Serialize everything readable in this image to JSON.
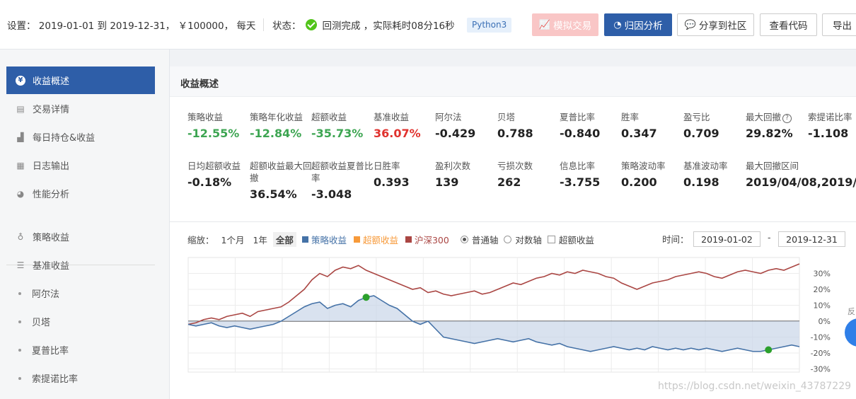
{
  "topbar": {
    "settings_text": "设置： 2019-01-01 到 2019-12-31， ￥100000， 每天",
    "status_label": "状态：",
    "status_text": "回测完成 ，实际耗时08分16秒",
    "python_badge": "Python3",
    "buttons": {
      "simulate": "模拟交易",
      "attribution": "归因分析",
      "share": "分享到社区",
      "view_code": "查看代码",
      "export": "导出"
    }
  },
  "sidebar": {
    "items": [
      {
        "label": "收益概述"
      },
      {
        "label": "交易详情"
      },
      {
        "label": "每日持仓&收益"
      },
      {
        "label": "日志输出"
      },
      {
        "label": "性能分析"
      },
      {
        "label": "策略收益"
      },
      {
        "label": "基准收益"
      },
      {
        "label": "阿尔法"
      },
      {
        "label": "贝塔"
      },
      {
        "label": "夏普比率"
      },
      {
        "label": "索提诺比率"
      }
    ]
  },
  "panel": {
    "title": "收益概述",
    "metrics_row1": [
      {
        "label": "策略收益",
        "value": "-12.55%",
        "color": "green"
      },
      {
        "label": "策略年化收益",
        "value": "-12.84%",
        "color": "green"
      },
      {
        "label": "超额收益",
        "value": "-35.73%",
        "color": "green"
      },
      {
        "label": "基准收益",
        "value": "36.07%",
        "color": "red"
      },
      {
        "label": "阿尔法",
        "value": "-0.429",
        "color": ""
      },
      {
        "label": "贝塔",
        "value": "0.788",
        "color": ""
      },
      {
        "label": "夏普比率",
        "value": "-0.840",
        "color": ""
      },
      {
        "label": "胜率",
        "value": "0.347",
        "color": ""
      },
      {
        "label": "盈亏比",
        "value": "0.709",
        "color": ""
      },
      {
        "label": "最大回撤",
        "value": "29.82%",
        "color": ""
      },
      {
        "label": "索提诺比率",
        "value": "-1.108",
        "color": ""
      }
    ],
    "metrics_row2": [
      {
        "label": "日均超额收益",
        "value": "-0.18%"
      },
      {
        "label": "超额收益最大回撤",
        "value": "36.54%"
      },
      {
        "label": "超额收益夏普比率",
        "value": "-3.048"
      },
      {
        "label": "日胜率",
        "value": "0.393"
      },
      {
        "label": "盈利次数",
        "value": "139"
      },
      {
        "label": "亏损次数",
        "value": "262"
      },
      {
        "label": "信息比率",
        "value": "-3.755"
      },
      {
        "label": "策略波动率",
        "value": "0.200"
      },
      {
        "label": "基准波动率",
        "value": "0.198"
      },
      {
        "label": "最大回撤区间",
        "value": "2019/04/08,2019/1"
      }
    ],
    "chart_controls": {
      "zoom_label": "缩放：",
      "zoom_options": [
        "1个月",
        "1年",
        "全部"
      ],
      "legend": [
        {
          "name": "策略收益",
          "color": "#4572a7"
        },
        {
          "name": "超额收益",
          "color": "#f79a3a"
        },
        {
          "name": "沪深300",
          "color": "#aa4643"
        }
      ],
      "axis_options": [
        "普通轴",
        "对数轴"
      ],
      "excess_checkbox": "超额收益",
      "time_label": "时间：",
      "start_date": "2019-01-02",
      "end_date": "2019-12-31",
      "date_sep": "-"
    }
  },
  "chart_data": {
    "type": "line",
    "ylim": [
      -32,
      40
    ],
    "y_ticks": [
      "30%",
      "20%",
      "10%",
      "0%",
      "-10%",
      "-20%",
      "-30%"
    ],
    "y_tick_values": [
      30,
      20,
      10,
      0,
      -10,
      -20,
      -30
    ],
    "grid": true,
    "series": [
      {
        "name": "沪深300",
        "color": "#aa4643",
        "values": [
          -2,
          -1,
          1,
          2,
          1,
          3,
          4,
          5,
          3,
          6,
          7,
          8,
          9,
          12,
          16,
          20,
          26,
          30,
          28,
          32,
          34,
          33,
          35,
          32,
          30,
          28,
          26,
          24,
          22,
          20,
          21,
          18,
          19,
          17,
          16,
          17,
          18,
          19,
          17,
          18,
          20,
          22,
          24,
          23,
          25,
          27,
          28,
          30,
          29,
          31,
          30,
          32,
          31,
          30,
          28,
          27,
          24,
          22,
          20,
          22,
          24,
          25,
          26,
          28,
          29,
          30,
          31,
          30,
          28,
          27,
          29,
          31,
          32,
          31,
          30,
          32,
          33,
          32,
          34,
          36
        ]
      },
      {
        "name": "策略收益",
        "color": "#4572a7",
        "values": [
          -2,
          -3,
          -2,
          -1,
          -3,
          -4,
          -3,
          -4,
          -5,
          -4,
          -3,
          -2,
          0,
          3,
          6,
          9,
          11,
          12,
          8,
          10,
          11,
          9,
          13,
          15,
          16,
          13,
          10,
          8,
          4,
          0,
          -2,
          0,
          -5,
          -10,
          -11,
          -12,
          -13,
          -14,
          -13,
          -12,
          -11,
          -12,
          -13,
          -12,
          -11,
          -13,
          -14,
          -15,
          -14,
          -16,
          -17,
          -18,
          -19,
          -18,
          -17,
          -16,
          -17,
          -18,
          -17,
          -18,
          -16,
          -17,
          -18,
          -17,
          -18,
          -17,
          -18,
          -17,
          -18,
          -19,
          -18,
          -17,
          -18,
          -19,
          -19,
          -18,
          -17,
          -16,
          -15,
          -16
        ]
      }
    ],
    "markers": [
      {
        "series": "策略收益",
        "index": 23,
        "color": "#2ca02c"
      },
      {
        "series": "策略收益",
        "index": 75,
        "color": "#2ca02c"
      }
    ]
  },
  "watermark": "https://blog.csdn.net/weixin_43787229"
}
